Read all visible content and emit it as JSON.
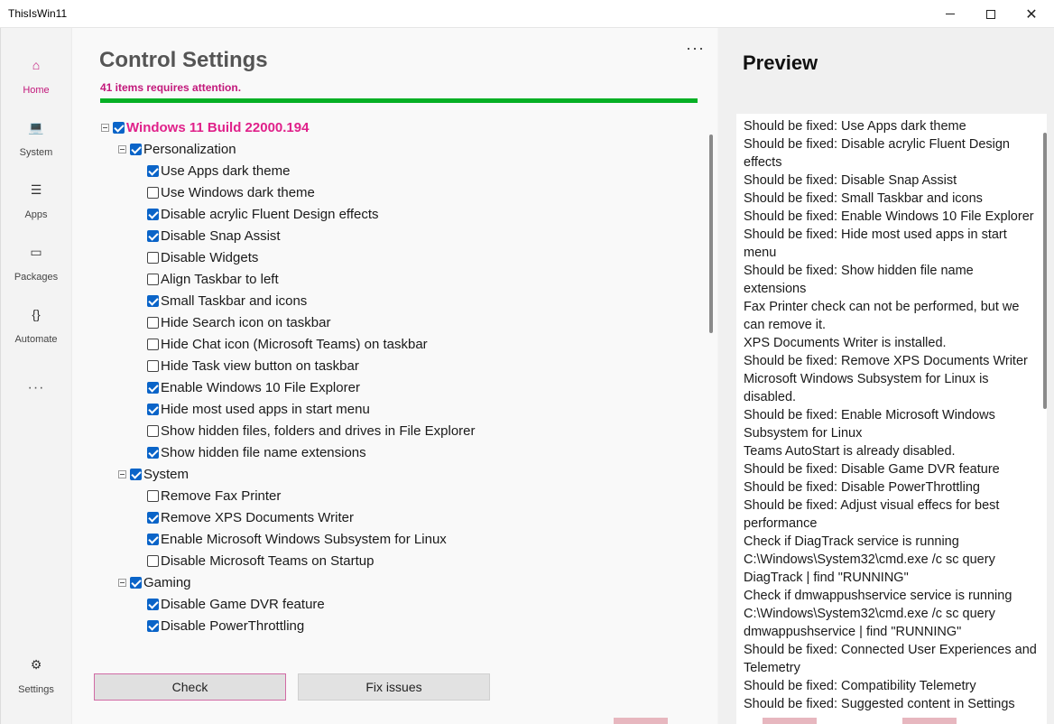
{
  "window": {
    "title": "ThisIsWin11",
    "minimize_glyph": "",
    "maximize_glyph": "",
    "close_glyph": "✕"
  },
  "nav": {
    "items": [
      {
        "label": "Home",
        "icon": "home-icon",
        "glyph": "⌂",
        "active": true
      },
      {
        "label": "System",
        "icon": "laptop-icon",
        "glyph": "💻",
        "active": false
      },
      {
        "label": "Apps",
        "icon": "list-icon",
        "glyph": "☰",
        "active": false
      },
      {
        "label": "Packages",
        "icon": "package-icon",
        "glyph": "▭",
        "active": false
      },
      {
        "label": "Automate",
        "icon": "braces-icon",
        "glyph": "{}",
        "active": false
      }
    ],
    "more": "···",
    "settings": {
      "label": "Settings",
      "icon": "gear-icon",
      "glyph": "⚙"
    }
  },
  "main": {
    "title": "Control Settings",
    "attention": "41 items requires attention.",
    "progress_percent": 100,
    "more": "···",
    "accent": "#c2187b",
    "progress_color": "#06b025"
  },
  "tree": {
    "root": {
      "label": "Windows 11 Build 22000.194",
      "checked": true
    },
    "groups": [
      {
        "label": "Personalization",
        "checked": true,
        "items": [
          {
            "label": "Use Apps dark theme",
            "checked": true
          },
          {
            "label": "Use Windows dark theme",
            "checked": false
          },
          {
            "label": "Disable acrylic Fluent Design effects",
            "checked": true
          },
          {
            "label": "Disable Snap Assist",
            "checked": true
          },
          {
            "label": "Disable Widgets",
            "checked": false
          },
          {
            "label": "Align Taskbar to left",
            "checked": false
          },
          {
            "label": "Small Taskbar and icons",
            "checked": true
          },
          {
            "label": "Hide Search icon on taskbar",
            "checked": false
          },
          {
            "label": "Hide Chat icon (Microsoft Teams) on taskbar",
            "checked": false
          },
          {
            "label": "Hide Task view button on taskbar",
            "checked": false
          },
          {
            "label": "Enable Windows 10 File Explorer",
            "checked": true
          },
          {
            "label": "Hide most used apps in start menu",
            "checked": true
          },
          {
            "label": "Show hidden files, folders and drives in File Explorer",
            "checked": false
          },
          {
            "label": "Show hidden file name extensions",
            "checked": true
          }
        ]
      },
      {
        "label": "System",
        "checked": true,
        "items": [
          {
            "label": "Remove Fax Printer",
            "checked": false
          },
          {
            "label": "Remove XPS Documents Writer",
            "checked": true
          },
          {
            "label": "Enable Microsoft Windows Subsystem for Linux",
            "checked": true
          },
          {
            "label": "Disable Microsoft Teams on Startup",
            "checked": false
          }
        ]
      },
      {
        "label": "Gaming",
        "checked": true,
        "items": [
          {
            "label": "Disable Game DVR feature",
            "checked": true
          },
          {
            "label": "Disable PowerThrottling",
            "checked": true
          }
        ]
      }
    ]
  },
  "buttons": {
    "check": "Check",
    "fix": "Fix issues"
  },
  "preview": {
    "title": "Preview",
    "lines": [
      "Should be fixed: Use Apps dark theme",
      "Should be fixed: Disable acrylic Fluent Design",
      "effects",
      "Should be fixed: Disable Snap Assist",
      "Should be fixed: Small Taskbar and icons",
      "Should be fixed: Enable Windows 10 File Explorer",
      "Should be fixed: Hide most used apps in start",
      "menu",
      "Should be fixed: Show hidden file name",
      "extensions",
      "Fax Printer check can not be performed, but we",
      "can remove it.",
      "XPS Documents Writer is installed.",
      "Should be fixed: Remove XPS Documents Writer",
      "Microsoft Windows Subsystem for Linux is",
      "disabled.",
      "Should be fixed: Enable Microsoft Windows",
      "Subsystem for Linux",
      "Teams AutoStart is already disabled.",
      "Should be fixed: Disable Game DVR feature",
      "Should be fixed: Disable PowerThrottling",
      "Should be fixed: Adjust visual effecs for best",
      "performance",
      "Check if DiagTrack service is running",
      "C:\\Windows\\System32\\cmd.exe /c sc query",
      "DiagTrack | find \"RUNNING\"",
      "Check if dmwappushservice service is running",
      "C:\\Windows\\System32\\cmd.exe /c sc query",
      "dmwappushservice | find \"RUNNING\"",
      "Should be fixed: Connected User Experiences and",
      "Telemetry",
      "Should be fixed: Compatibility Telemetry",
      "Should be fixed: Suggested content in Settings"
    ]
  }
}
